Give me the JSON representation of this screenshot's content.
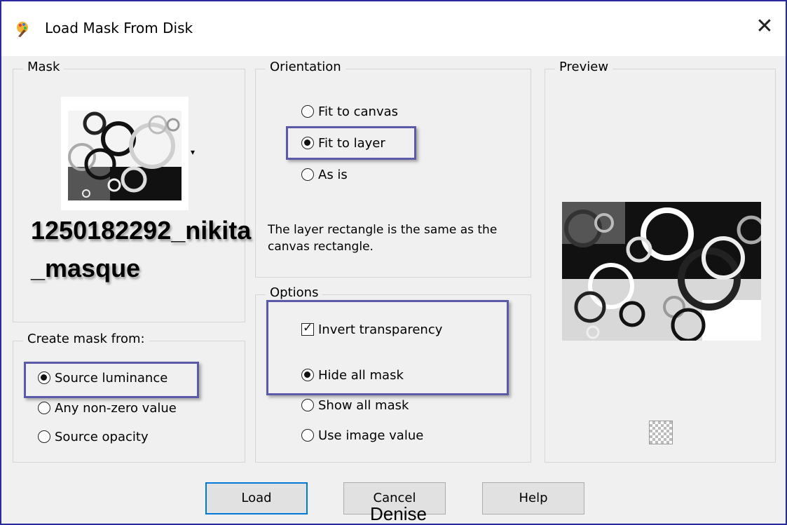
{
  "window": {
    "title": "Load Mask From Disk",
    "close_glyph": "✕",
    "icon": "paint-shop-pro-icon"
  },
  "mask_group": {
    "label": "Mask",
    "mask_name": "1250182292_nikita _masque",
    "dropdown_glyph": "▾"
  },
  "create_mask_group": {
    "label": "Create mask from:",
    "options": [
      {
        "label": "Source luminance",
        "checked": true
      },
      {
        "label": "Any non-zero value",
        "checked": false
      },
      {
        "label": "Source opacity",
        "checked": false
      }
    ]
  },
  "orientation_group": {
    "label": "Orientation",
    "options": [
      {
        "label": "Fit to canvas",
        "checked": false
      },
      {
        "label": "Fit to layer",
        "checked": true
      },
      {
        "label": "As is",
        "checked": false
      }
    ],
    "description": "The layer rectangle is the same as the canvas rectangle."
  },
  "options_group": {
    "label": "Options",
    "invert_transparency": {
      "label": "Invert transparency",
      "checked": true
    },
    "options": [
      {
        "label": "Hide all mask",
        "checked": true
      },
      {
        "label": "Show all mask",
        "checked": false
      },
      {
        "label": "Use image value",
        "checked": false
      }
    ]
  },
  "preview_group": {
    "label": "Preview"
  },
  "buttons": {
    "load": "Load",
    "cancel": "Cancel",
    "help": "Help"
  },
  "watermark": "Denise",
  "colors": {
    "highlight": "#5a5aa8",
    "window_border": "#2a2a9c",
    "default_button_border": "#0078d7"
  }
}
